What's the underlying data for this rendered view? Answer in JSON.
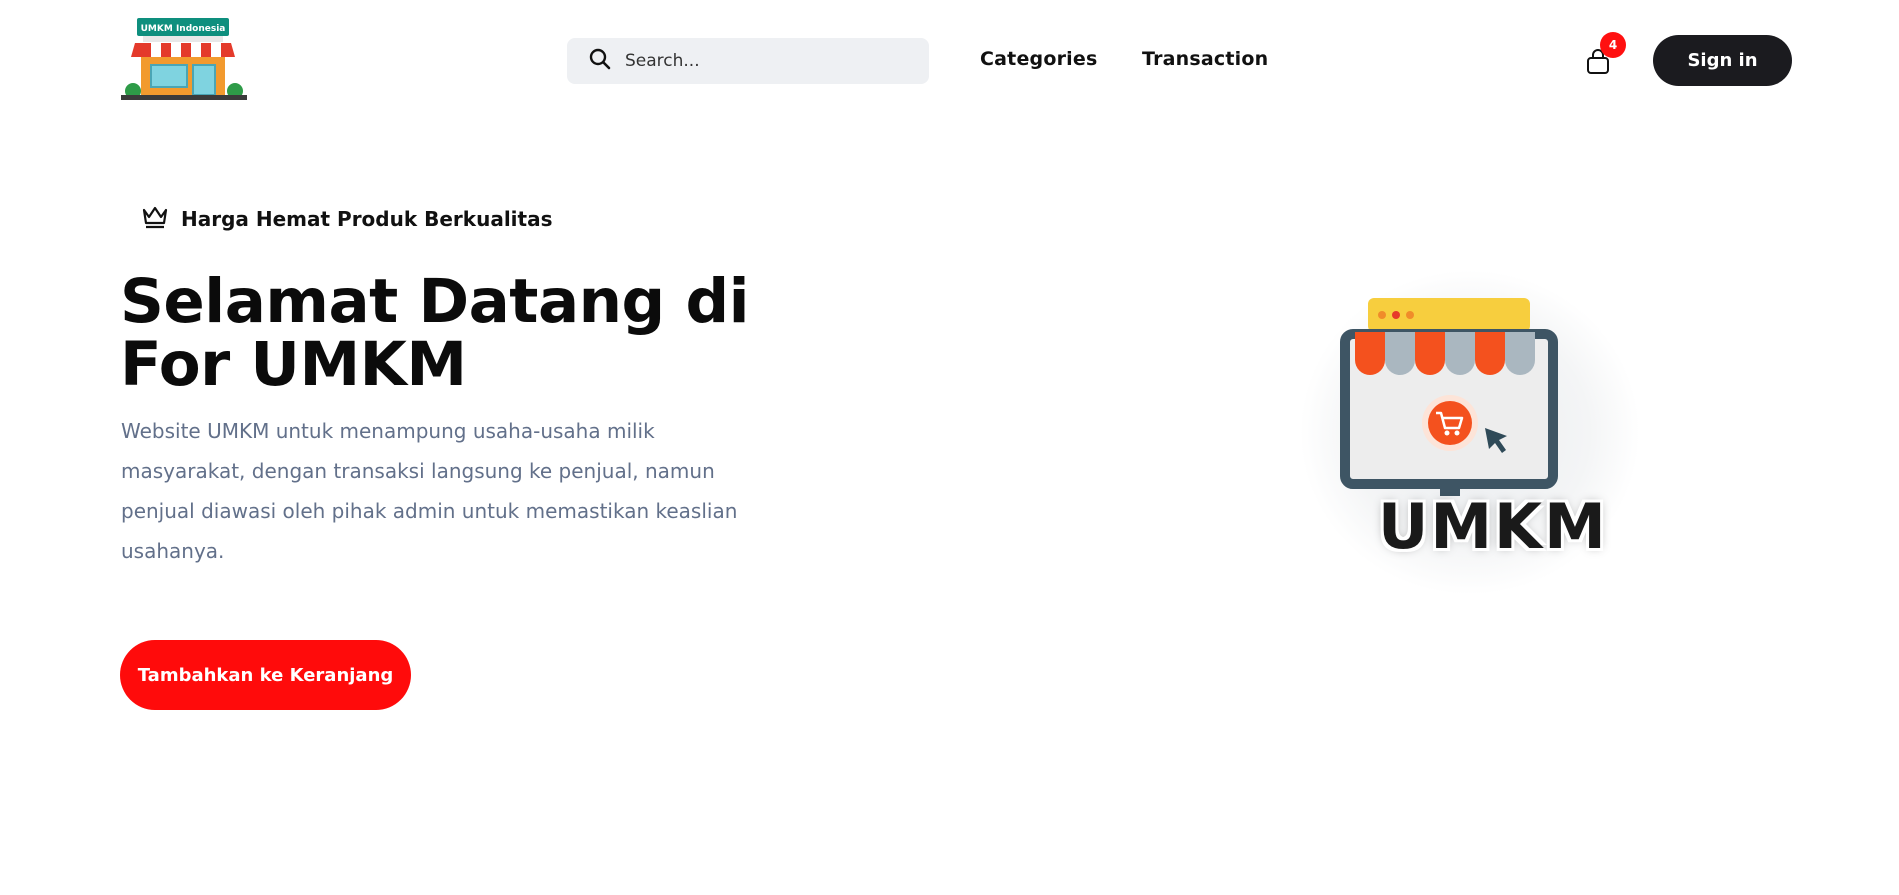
{
  "header": {
    "logo_sign": "UMKM Indonesia",
    "search_placeholder": "Search...",
    "nav": [
      "Categories",
      "Transaction"
    ],
    "cart_count": "4",
    "signin_label": "Sign in"
  },
  "hero": {
    "tagline": "Harga Hemat Produk Berkualitas",
    "title_line1": "Selamat Datang di",
    "title_line2": "For UMKM",
    "description": "Website UMKM untuk menampung usaha-usaha milik masyarakat, dengan transaksi langsung ke penjual, namun penjual diawasi oleh pihak admin untuk memastikan keaslian usahanya.",
    "cta_label": "Tambahkan ke Keranjang",
    "image_word": "UMKM"
  },
  "colors": {
    "accent_red": "#ff0b0b",
    "dark": "#1b1b1f",
    "text_muted": "#62708a",
    "search_bg": "#eef0f3"
  },
  "icons": [
    "store-logo-icon",
    "search-icon",
    "shopping-bag-icon",
    "crown-icon",
    "online-shop-illustration"
  ]
}
